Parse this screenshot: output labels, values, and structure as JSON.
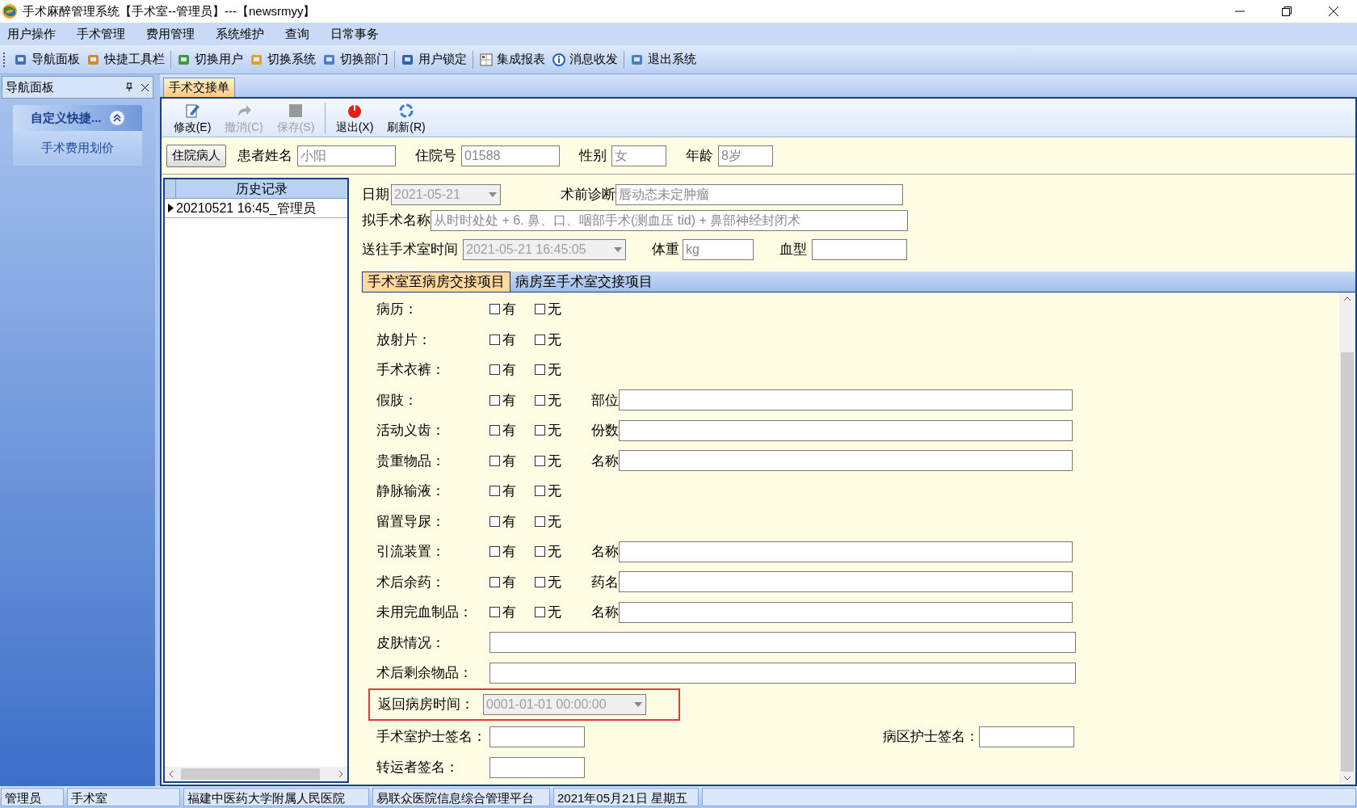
{
  "window": {
    "title": "手术麻醉管理系统【手术室--管理员】---【newsrmyy】"
  },
  "menu": [
    "用户操作",
    "手术管理",
    "费用管理",
    "系统维护",
    "查询",
    "日常事务"
  ],
  "toolbar": [
    {
      "label": "导航面板"
    },
    {
      "label": "快捷工具栏"
    },
    {
      "label": "切换用户"
    },
    {
      "label": "切换系统"
    },
    {
      "label": "切换部门"
    },
    {
      "label": "用户锁定"
    },
    {
      "label": "集成报表"
    },
    {
      "label": "消息收发"
    },
    {
      "label": "退出系统"
    }
  ],
  "nav_panel": {
    "title": "导航面板",
    "group": {
      "title": "自定义快捷...",
      "expanded": true
    },
    "items": [
      "手术费用划价"
    ]
  },
  "doc_tabs": [
    {
      "label": "手术交接单",
      "selected": true
    }
  ],
  "form_toolbar": [
    {
      "label": "修改(E)",
      "disabled": false
    },
    {
      "label": "撤消(C)",
      "disabled": true
    },
    {
      "label": "保存(S)",
      "disabled": true
    },
    {
      "label": "退出(X)",
      "disabled": false
    },
    {
      "label": "刷新(R)",
      "disabled": false
    }
  ],
  "patient": {
    "button": "住院病人",
    "fields": [
      {
        "label": "患者姓名",
        "value": "小阳"
      },
      {
        "label": "住院号",
        "value": "01588"
      },
      {
        "label": "性别",
        "value": "女"
      },
      {
        "label": "年龄",
        "value": "8岁"
      }
    ]
  },
  "history": {
    "title": "历史记录",
    "rows": [
      {
        "text": "20210521 16:45_管理员",
        "selected": true
      }
    ]
  },
  "details": {
    "date": {
      "label": "日期",
      "value": "2021-05-21"
    },
    "diagnosis": {
      "label": "术前诊断",
      "value": "唇动态未定肿瘤"
    },
    "operation": {
      "label": "拟手术名称",
      "value": "从时时处处 + 6. 鼻、口、咽部手术(测血压  tid) + 鼻部神经封闭术"
    },
    "send_time": {
      "label": "送往手术室时间",
      "value": "2021-05-21 16:45:05"
    },
    "weight": {
      "label": "体重",
      "value": "kg"
    },
    "blood_type": {
      "label": "血型"
    }
  },
  "handover_tabs": [
    {
      "label": "手术室至病房交接项目",
      "selected": true
    },
    {
      "label": "病房至手术室交接项目",
      "selected": false
    }
  ],
  "items": [
    {
      "kind": "check",
      "label": "病历：",
      "options": [
        {
          "label": "有",
          "checked": false
        },
        {
          "label": "无",
          "checked": false
        }
      ]
    },
    {
      "kind": "check",
      "label": "放射片：",
      "options": [
        {
          "label": "有",
          "checked": false
        },
        {
          "label": "无",
          "checked": false
        }
      ]
    },
    {
      "kind": "check",
      "label": "手术衣裤：",
      "options": [
        {
          "label": "有",
          "checked": false
        },
        {
          "label": "无",
          "checked": false
        }
      ]
    },
    {
      "kind": "check",
      "label": "假肢：",
      "options": [
        {
          "label": "有",
          "checked": false
        },
        {
          "label": "无",
          "checked": false
        }
      ],
      "field_label": "部位"
    },
    {
      "kind": "check",
      "label": "活动义齿：",
      "options": [
        {
          "label": "有",
          "checked": false
        },
        {
          "label": "无",
          "checked": false
        }
      ],
      "field_label": "份数"
    },
    {
      "kind": "check",
      "label": "贵重物品：",
      "options": [
        {
          "label": "有",
          "checked": false
        },
        {
          "label": "无",
          "checked": false
        }
      ],
      "field_label": "名称"
    },
    {
      "kind": "check",
      "label": "静脉输液：",
      "options": [
        {
          "label": "有",
          "checked": false
        },
        {
          "label": "无",
          "checked": false
        }
      ]
    },
    {
      "kind": "check",
      "label": "留置导尿：",
      "options": [
        {
          "label": "有",
          "checked": false
        },
        {
          "label": "无",
          "checked": false
        }
      ]
    },
    {
      "kind": "check",
      "label": "引流装置：",
      "options": [
        {
          "label": "有",
          "checked": false
        },
        {
          "label": "无",
          "checked": false
        }
      ],
      "field_label": "名称"
    },
    {
      "kind": "check",
      "label": "术后余药：",
      "options": [
        {
          "label": "有",
          "checked": false
        },
        {
          "label": "无",
          "checked": false
        }
      ],
      "field_label": "药名"
    },
    {
      "kind": "check",
      "label": "未用完血制品：",
      "options": [
        {
          "label": "有",
          "checked": false
        },
        {
          "label": "无",
          "checked": false
        }
      ],
      "field_label": "名称"
    },
    {
      "kind": "text",
      "label": "皮肤情况："
    },
    {
      "kind": "text",
      "label": "术后剩余物品："
    },
    {
      "kind": "datetime",
      "label": "返回病房时间：",
      "value": "0001-01-01 00:00:00",
      "highlighted": true
    },
    {
      "kind": "signatures",
      "label": "手术室护士签名：",
      "second_label": "病区护士签名："
    },
    {
      "kind": "signature",
      "label": "转运者签名："
    }
  ],
  "status_bar": [
    "管理员",
    "手术室",
    "福建中医药大学附属人民医院",
    "易联众医院信息综合管理平台",
    "2021年05月21日 星期五"
  ]
}
